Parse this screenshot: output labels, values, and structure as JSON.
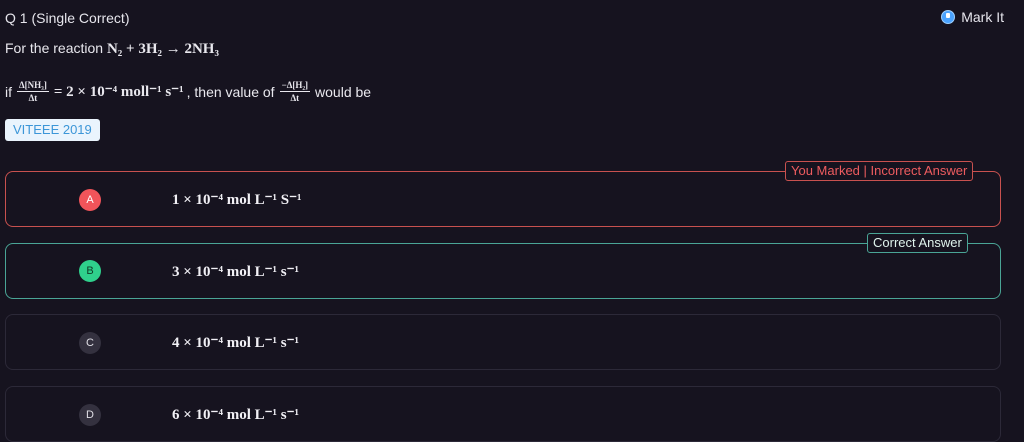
{
  "question": {
    "header": "Q 1 (Single Correct)",
    "mark_label": "Mark It",
    "line1_prefix": "For the reaction ",
    "line1_equation": "N₂ + 3H₂ → 2NH₃",
    "line2_prefix": "if",
    "frac1_num": "Δ[NH₃]",
    "frac1_den": "Δt",
    "line2_middle": "= 2 × 10⁻⁴ moll⁻¹ s⁻¹",
    "line2_then": ", then value of",
    "frac2_num": "−Δ[H₂]",
    "frac2_den": "Δt",
    "line2_suffix": "would be",
    "tag": "VITEEE 2019"
  },
  "options": [
    {
      "letter": "A",
      "text": "1 × 10⁻⁴ mol L⁻¹ S⁻¹",
      "badge": "You Marked | Incorrect Answer",
      "status": "wrong"
    },
    {
      "letter": "B",
      "text": "3 × 10⁻⁴ mol L⁻¹ s⁻¹",
      "badge": "Correct Answer",
      "status": "correct"
    },
    {
      "letter": "C",
      "text": "4 × 10⁻⁴ mol L⁻¹ s⁻¹",
      "status": "none"
    },
    {
      "letter": "D",
      "text": "6 × 10⁻⁴ mol L⁻¹ s⁻¹",
      "status": "none"
    }
  ],
  "colors": {
    "background": "#16131f",
    "wrong": "#f1545a",
    "correct": "#2fd08c",
    "tag_text": "#3c96d8",
    "bookmark": "#4aa3ff"
  },
  "icons": {
    "mark": "bookmark-icon"
  }
}
